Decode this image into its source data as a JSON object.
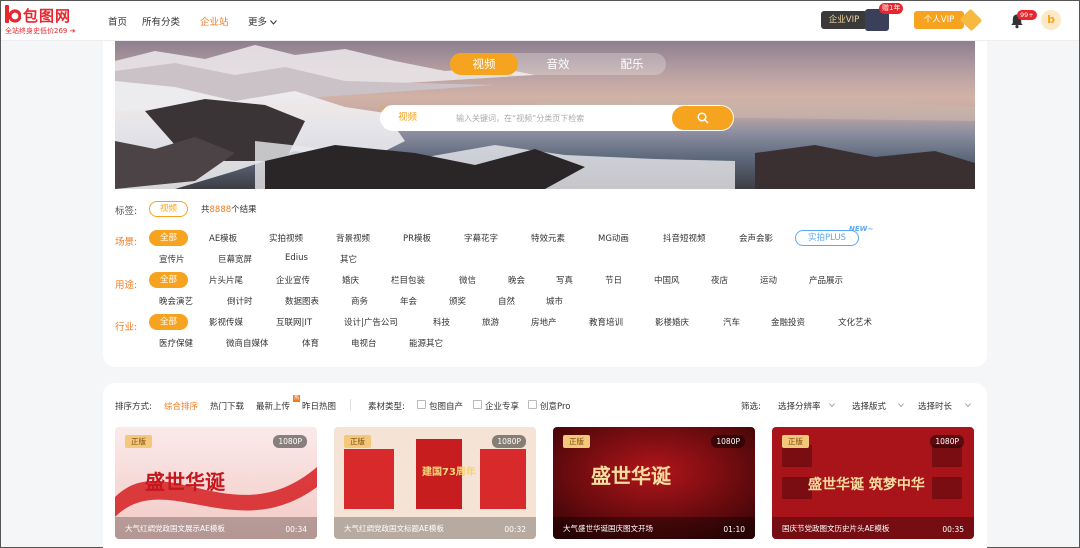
{
  "logo": {
    "text": "包图网",
    "subtitle": "全站终身史低价269",
    "arrow": "➔"
  },
  "nav": {
    "items": [
      "首页",
      "所有分类",
      "企业站",
      "更多"
    ],
    "active_index": 2
  },
  "vip": {
    "corporate_label": "企业VIP",
    "corporate_badge": "赠1年",
    "personal_label": "个人VIP"
  },
  "notifications": {
    "count": "99+"
  },
  "avatar": {
    "letter": "b"
  },
  "banner": {
    "tabs": [
      "视频",
      "音效",
      "配乐"
    ],
    "active_tab": 0,
    "search_type": "视频",
    "search_placeholder": "输入关键词，在“视频”分类页下检索"
  },
  "tags": {
    "label": "标签:",
    "selected": "视频",
    "result_prefix": "共",
    "result_count": "8888",
    "result_suffix": "个结果"
  },
  "scene": {
    "label": "场景:",
    "items": [
      "全部",
      "AE模板",
      "实拍视频",
      "背景视频",
      "PR模板",
      "字幕花字",
      "特效元素",
      "MG动画",
      "抖音短视频",
      "会声会影",
      "实拍PLUS",
      "宣传片",
      "巨幕宽屏",
      "Edius",
      "其它"
    ],
    "new_tag": "NEW~"
  },
  "usage": {
    "label": "用途:",
    "items": [
      "全部",
      "片头片尾",
      "企业宣传",
      "婚庆",
      "栏目包装",
      "微信",
      "晚会",
      "写真",
      "节日",
      "中国风",
      "夜店",
      "运动",
      "产品展示",
      "晚会演艺",
      "倒计时",
      "数据图表",
      "商务",
      "年会",
      "颁奖",
      "自然",
      "城市"
    ]
  },
  "industry": {
    "label": "行业:",
    "items": [
      "全部",
      "影视传媒",
      "互联网|IT",
      "设计|广告公司",
      "科技",
      "旅游",
      "房地产",
      "教育培训",
      "影楼婚庆",
      "汽车",
      "金融投资",
      "文化艺术",
      "医疗保健",
      "微商自媒体",
      "体育",
      "电视台",
      "能源其它"
    ]
  },
  "sort": {
    "label": "排序方式:",
    "items": [
      "综合排序",
      "热门下载",
      "最新上传",
      "昨日热图"
    ],
    "hot_mark": "热",
    "material_label": "素材类型:",
    "materials": [
      "包图自产",
      "企业专享",
      "创意Pro"
    ],
    "filter_label": "筛选:",
    "filters": [
      "选择分辨率",
      "选择版式",
      "选择时长"
    ]
  },
  "cards": [
    {
      "badge": "正版",
      "resolution": "1080P",
      "title": "大气红绸党政国文展示AE模板",
      "duration": "00:34",
      "art_text": "盛世华诞"
    },
    {
      "badge": "正版",
      "resolution": "1080P",
      "title": "大气红绸党政国文标题AE模板",
      "duration": "00:32",
      "art_text": "建国73周年"
    },
    {
      "badge": "正版",
      "resolution": "1080P",
      "title": "大气盛世华诞国庆图文开场",
      "duration": "01:10",
      "art_text": "盛世华诞"
    },
    {
      "badge": "正版",
      "resolution": "1080P",
      "title": "国庆节党政图文历史片头AE模板",
      "duration": "00:35",
      "art_text": "盛世华诞 筑梦中华"
    }
  ],
  "colors": {
    "accent": "#f6a31f",
    "link": "#f47a1f",
    "brand": "#e8262d",
    "plus": "#5aa9f5"
  }
}
